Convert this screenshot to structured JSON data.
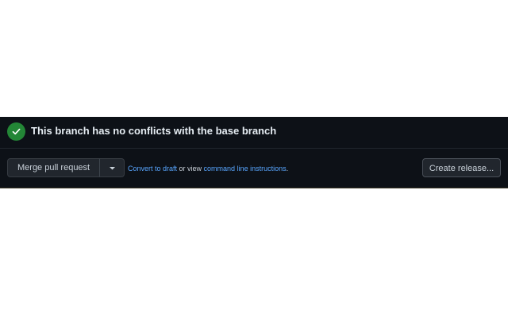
{
  "merge_box": {
    "status": {
      "icon": "check-circle-icon",
      "title": "This branch has no conflicts with the base branch"
    },
    "actions": {
      "merge_label": "Merge pull request",
      "caret_icon": "triangle-down-icon",
      "convert_draft_link": "Convert to draft",
      "or_view_text": " or view ",
      "command_line_link": "command line instructions",
      "trailing_period": ".",
      "create_release_label": "Create release..."
    }
  },
  "colors": {
    "background": "#0d1117",
    "success": "#238636",
    "link": "#58a6ff",
    "button_bg": "#21262d",
    "text": "#e6edf3"
  }
}
